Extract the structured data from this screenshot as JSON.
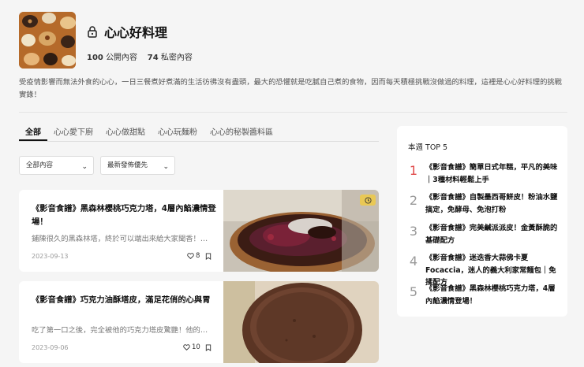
{
  "profile": {
    "title": "心心好料理",
    "public_count": "100",
    "public_label": "公開內容",
    "private_count": "74",
    "private_label": "私密內容",
    "description": "受疫情影響而無法外食的心心，一日三餐煮好煮滿的生活彷彿沒有盡頭，最大的恐懼就是吃膩自己煮的食物，因而每天積極挑戰沒做過的料理，這裡是心心好料理的挑戰實錄！"
  },
  "tabs": [
    {
      "label": "全部"
    },
    {
      "label": "心心愛下廚"
    },
    {
      "label": "心心做甜點"
    },
    {
      "label": "心心玩麵粉"
    },
    {
      "label": "心心的秘製醬料區"
    }
  ],
  "filters": {
    "content_select": "全部內容",
    "sort_select": "最新發佈優先"
  },
  "posts": [
    {
      "title": "《影音食譜》黑森林櫻桃巧克力塔，4層內餡濃情登場！",
      "excerpt": "鋪陳很久的黑森林塔，終於可以端出來給大家聞香！…",
      "date": "2023-09-13",
      "likes": "8"
    },
    {
      "title": "《影音食譜》巧克力油酥塔皮，滿足花俏的心與胃",
      "excerpt": "吃了第一口之後，完全被他的巧克力塔皮驚艷！他的…",
      "date": "2023-09-06",
      "likes": "10"
    }
  ],
  "top5": {
    "heading": "本週 TOP 5",
    "items": [
      {
        "rank": "1",
        "title": "《影音食譜》簡單日式年糕，平凡的美味｜3種材料輕鬆上手"
      },
      {
        "rank": "2",
        "title": "《影音食譜》自製墨西哥餅皮！粉油水鹽搞定，免酵母、免泡打粉"
      },
      {
        "rank": "3",
        "title": "《影音食譜》完美鹹派派皮！金黃酥脆的基礎配方"
      },
      {
        "rank": "4",
        "title": "《影音食譜》迷迭香大蒜佛卡夏 Focaccia，迷人的義大利家常麵包｜免揉配方"
      },
      {
        "rank": "5",
        "title": "《影音食譜》黑森林櫻桃巧克力塔，4層內餡濃情登場！"
      }
    ]
  },
  "colors": {
    "rank_first": "#e04a4a",
    "badge": "#ebc850"
  },
  "icons": [
    "lock-icon",
    "chevron-down-icon",
    "heart-icon",
    "bookmark-icon",
    "video-badge-icon"
  ]
}
